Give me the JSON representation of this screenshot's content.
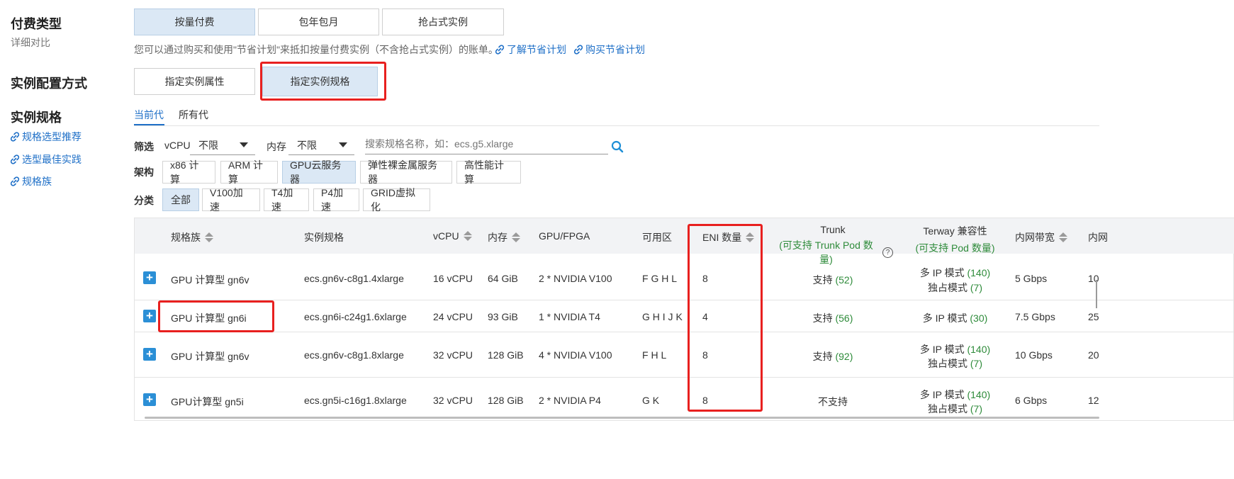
{
  "billing": {
    "title": "付费类型",
    "subtitle": "详细对比",
    "options": [
      "按量付费",
      "包年包月",
      "抢占式实例"
    ],
    "note": "您可以通过购买和使用\"节省计划\"来抵扣按量付费实例（不含抢占式实例）的账单。",
    "link1": "了解节省计划",
    "link2": "购买节省计划"
  },
  "config_method": {
    "title": "实例配置方式",
    "options": [
      "指定实例属性",
      "指定实例规格"
    ]
  },
  "spec": {
    "title": "实例规格",
    "links": [
      "规格选型推荐",
      "选型最佳实践",
      "规格族"
    ],
    "tabs": [
      "当前代",
      "所有代"
    ]
  },
  "filter": {
    "label": "筛选",
    "vcpu_label": "vCPU",
    "vcpu_value": "不限",
    "mem_label": "内存",
    "mem_value": "不限",
    "search_placeholder": "搜索规格名称，如：ecs.g5.xlarge",
    "arch_label": "架构",
    "arch_options": [
      "x86 计算",
      "ARM 计算",
      "GPU云服务器",
      "弹性裸金属服务器",
      "高性能计算"
    ],
    "cat_label": "分类",
    "cat_options": [
      "全部",
      "V100加速",
      "T4加速",
      "P4加速",
      "GRID虚拟化"
    ]
  },
  "table": {
    "headers": {
      "family": "规格族",
      "spec": "实例规格",
      "vcpu": "vCPU",
      "mem": "内存",
      "gpu": "GPU/FPGA",
      "zone": "可用区",
      "eni": "ENI 数量",
      "trunk": "Trunk",
      "trunk_sub": "(可支持 Trunk Pod 数量)",
      "terway": "Terway 兼容性",
      "terway_sub": "(可支持 Pod 数量)",
      "bw": "内网带宽",
      "pps": "内网"
    },
    "rows": [
      {
        "family": "GPU 计算型 gn6v",
        "spec": "ecs.gn6v-c8g1.4xlarge",
        "vcpu": "16 vCPU",
        "mem": "64 GiB",
        "gpu": "2 * NVIDIA V100",
        "zone": "F G H L",
        "eni": "8",
        "trunk": "支持",
        "trunk_n": "(52)",
        "terway1": "多 IP 模式",
        "terway1_n": "(140)",
        "terway2": "独占模式",
        "terway2_n": "(7)",
        "bw": "5 Gbps",
        "pps": "10"
      },
      {
        "family": "GPU 计算型 gn6i",
        "spec": "ecs.gn6i-c24g1.6xlarge",
        "vcpu": "24 vCPU",
        "mem": "93 GiB",
        "gpu": "1 * NVIDIA T4",
        "zone": "G H I J K",
        "eni": "4",
        "trunk": "支持",
        "trunk_n": "(56)",
        "terway1": "多 IP 模式",
        "terway1_n": "(30)",
        "bw": "7.5 Gbps",
        "pps": "25"
      },
      {
        "family": "GPU 计算型 gn6v",
        "spec": "ecs.gn6v-c8g1.8xlarge",
        "vcpu": "32 vCPU",
        "mem": "128 GiB",
        "gpu": "4 * NVIDIA V100",
        "zone": "F H L",
        "eni": "8",
        "trunk": "支持",
        "trunk_n": "(92)",
        "terway1": "多 IP 模式",
        "terway1_n": "(140)",
        "terway2": "独占模式",
        "terway2_n": "(7)",
        "bw": "10 Gbps",
        "pps": "20"
      },
      {
        "family": "GPU计算型 gn5i",
        "spec": "ecs.gn5i-c16g1.8xlarge",
        "vcpu": "32 vCPU",
        "mem": "128 GiB",
        "gpu": "2 * NVIDIA P4",
        "zone": "G K",
        "eni": "8",
        "trunk": "不支持",
        "terway1": "多 IP 模式",
        "terway1_n": "(140)",
        "terway2": "独占模式",
        "terway2_n": "(7)",
        "bw": "6 Gbps",
        "pps": "12"
      }
    ]
  },
  "colors": {
    "highlight": "#e8201f",
    "link": "#1e6fc7",
    "active_bg": "#dbe8f5",
    "green": "#2e8b3a"
  }
}
